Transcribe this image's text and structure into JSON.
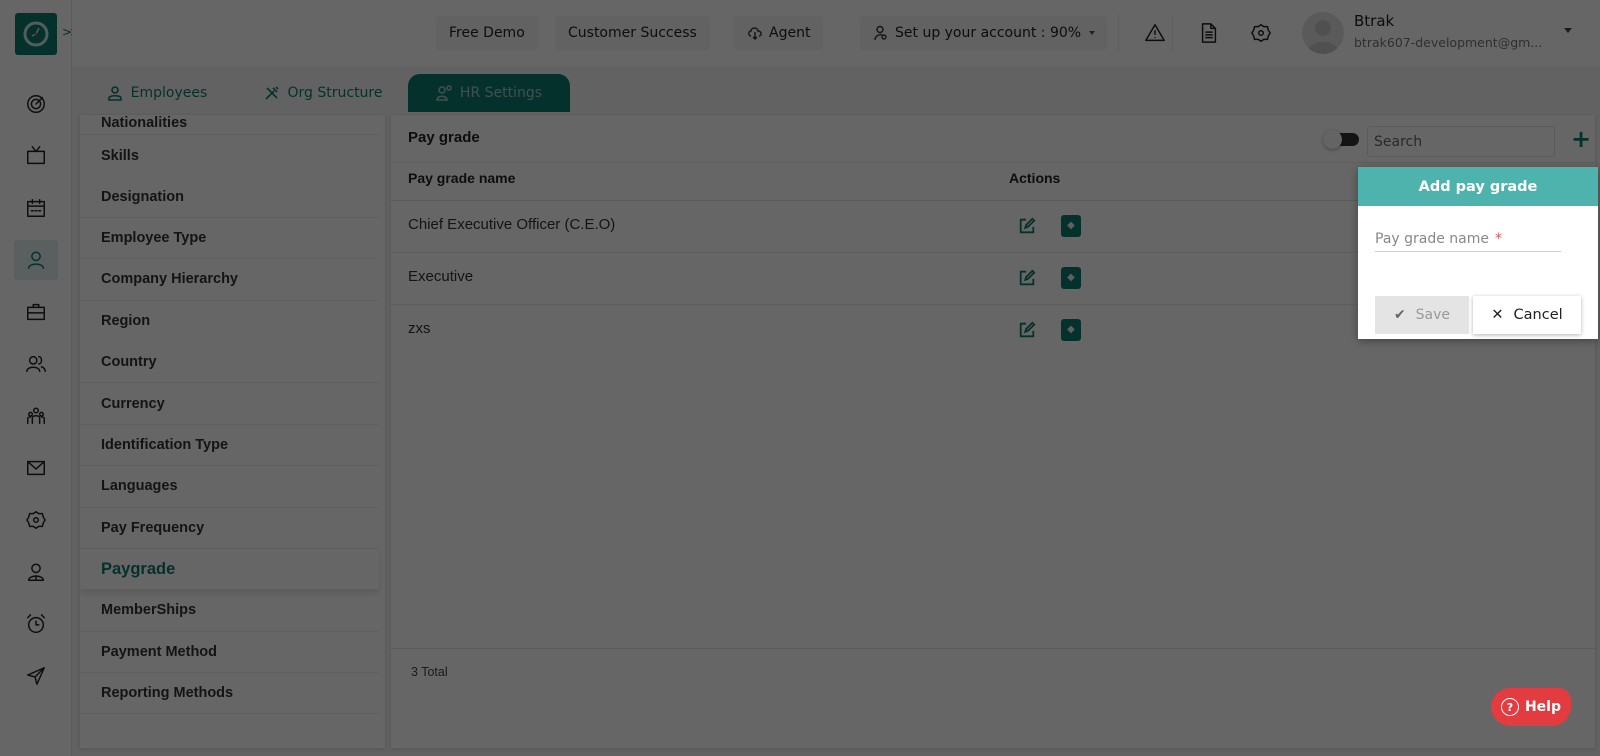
{
  "colors": {
    "brand": "#0e7c6f",
    "popup_header": "#4fb3ad",
    "help": "#e23b40",
    "required": "#e05555"
  },
  "topbar": {
    "free_demo": "Free Demo",
    "customer_success": "Customer Success",
    "agent": "Agent",
    "setup_account": "Set up your account : 90%",
    "icons": [
      "warning-icon",
      "document-icon",
      "settings-icon"
    ],
    "user": {
      "name": "Btrak",
      "email": "btrak607-development@gm..."
    }
  },
  "leftnav": {
    "expand_label": ">>>",
    "items": [
      {
        "icon": "dashboard-icon",
        "active": false
      },
      {
        "icon": "tv-icon",
        "active": false
      },
      {
        "icon": "calendar-icon",
        "active": false
      },
      {
        "icon": "user-icon",
        "active": true
      },
      {
        "icon": "briefcase-icon",
        "active": false
      },
      {
        "icon": "users-icon",
        "active": false
      },
      {
        "icon": "team-icon",
        "active": false
      },
      {
        "icon": "mail-icon",
        "active": false
      },
      {
        "icon": "settings-icon",
        "active": false
      },
      {
        "icon": "employee-icon",
        "active": false
      },
      {
        "icon": "alarm-icon",
        "active": false
      },
      {
        "icon": "send-icon",
        "active": false
      }
    ]
  },
  "tabs": [
    {
      "label": "Employees",
      "active": false
    },
    {
      "label": "Org Structure",
      "active": false
    },
    {
      "label": "HR Settings",
      "active": true
    }
  ],
  "settings_menu": {
    "items": [
      "Nationalities",
      "Skills",
      "Designation",
      "Employee Type",
      "Company Hierarchy",
      "Region",
      "Country",
      "Currency",
      "Identification Type",
      "Languages",
      "Pay Frequency",
      "Paygrade",
      "MemberShips",
      "Payment Method",
      "Reporting Methods"
    ],
    "active": "Paygrade"
  },
  "main": {
    "title": "Pay grade",
    "search_placeholder": "Search",
    "add_label": "+",
    "columns": [
      "Pay grade name",
      "Actions"
    ],
    "rows": [
      {
        "name": "Chief Executive Officer (C.E.O)"
      },
      {
        "name": "Executive"
      },
      {
        "name": "zxs"
      }
    ],
    "total": "3 Total"
  },
  "popup": {
    "title": "Add pay grade",
    "field_label": "Pay grade name",
    "field_required_mark": "*",
    "field_value": "",
    "save_label": "Save",
    "cancel_label": "Cancel"
  },
  "help": {
    "label": "Help"
  }
}
